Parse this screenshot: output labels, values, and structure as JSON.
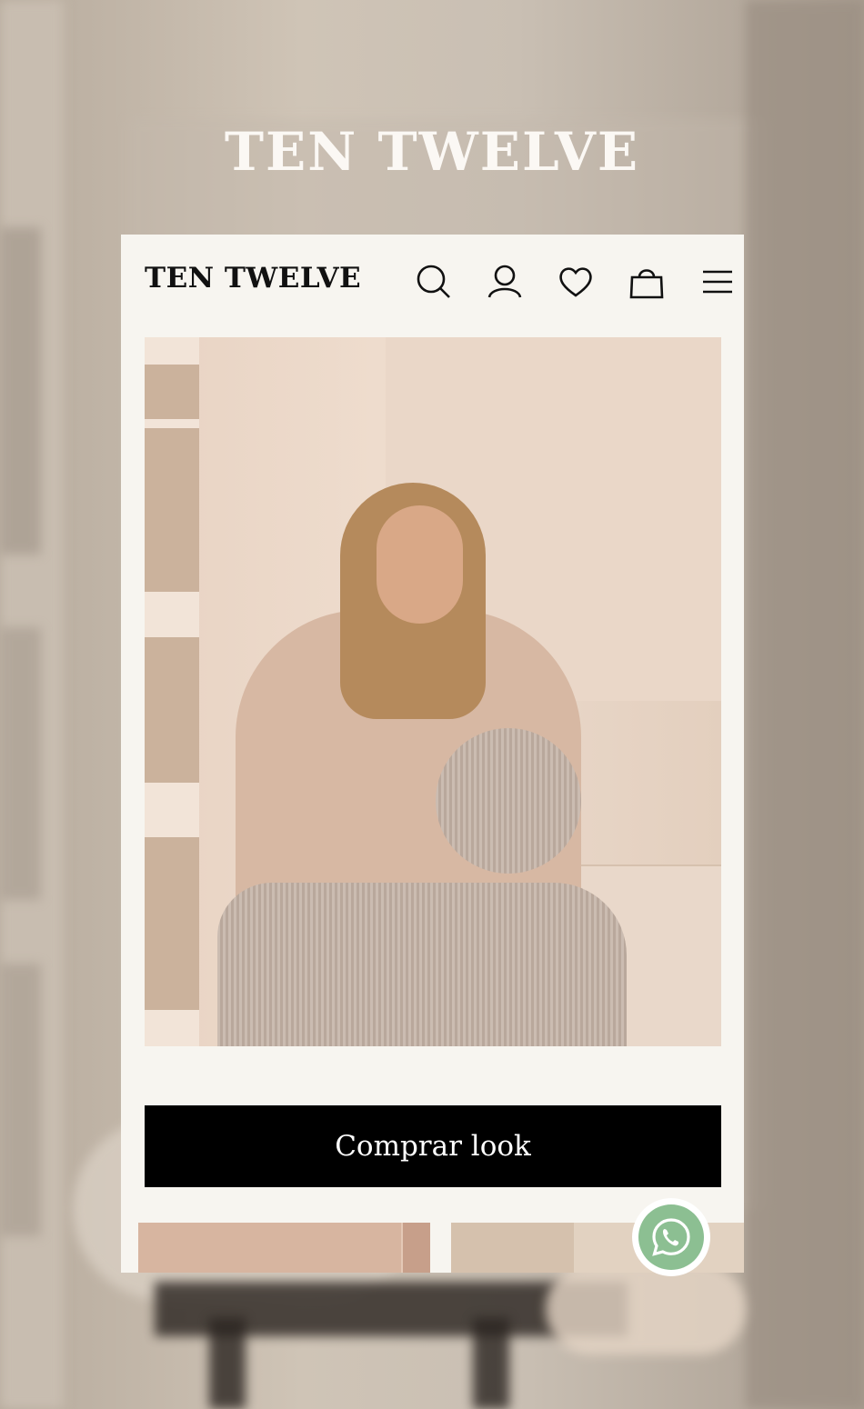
{
  "brand": {
    "title": "TEN TWELVE",
    "header_logo": "TEN TWELVE"
  },
  "header": {
    "icons": [
      "search-icon",
      "user-icon",
      "heart-icon",
      "bag-icon",
      "menu-icon"
    ]
  },
  "hero": {
    "cta_label": "Comprar look"
  },
  "colors": {
    "page_bg": "#f7f5f0",
    "cta_bg": "#000000",
    "cta_text": "#ffffff",
    "whatsapp": "#8cbf92"
  }
}
